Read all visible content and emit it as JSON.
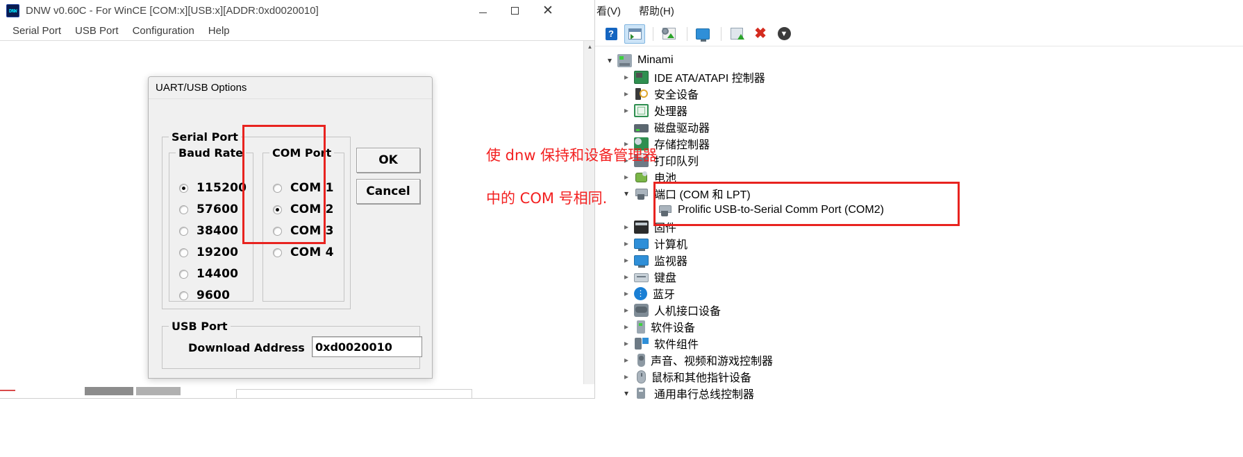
{
  "dnw": {
    "title": "DNW v0.60C - For WinCE   [COM:x][USB:x][ADDR:0xd0020010]",
    "app_icon": "DNW",
    "window_controls": {
      "minimize": "minimize-icon",
      "maximize": "maximize-icon",
      "close": "close-icon"
    },
    "menu": [
      "Serial Port",
      "USB Port",
      "Configuration",
      "Help"
    ]
  },
  "uart_dialog": {
    "title": "UART/USB Options",
    "serial_group": "Serial Port",
    "baud_group": "Baud Rate",
    "com_group": "COM Port",
    "usb_group": "USB Port",
    "baud_rates": [
      {
        "label": "115200",
        "checked": true
      },
      {
        "label": "57600",
        "checked": false
      },
      {
        "label": "38400",
        "checked": false
      },
      {
        "label": "19200",
        "checked": false
      },
      {
        "label": "14400",
        "checked": false
      },
      {
        "label": "9600",
        "checked": false
      }
    ],
    "com_ports": [
      {
        "label": "COM 1",
        "checked": false
      },
      {
        "label": "COM 2",
        "checked": true
      },
      {
        "label": "COM 3",
        "checked": false
      },
      {
        "label": "COM 4",
        "checked": false
      }
    ],
    "download_address_label": "Download Address",
    "download_address_value": "0xd0020010",
    "ok_label": "OK",
    "cancel_label": "Cancel",
    "highlight_color": "#e8231f"
  },
  "annotation": {
    "line1": "使 dnw 保持和设备管理器",
    "line2": "中的 COM 号相同.",
    "color": "#f32020"
  },
  "device_manager": {
    "menu": [
      "看(V)",
      "帮助(H)"
    ],
    "toolbar": [
      {
        "name": "help-icon"
      },
      {
        "name": "properties-icon",
        "selected": true
      },
      {
        "name": "scan-hardware-changes-icon"
      },
      {
        "name": "monitor-icon"
      },
      {
        "name": "update-driver-icon"
      },
      {
        "name": "disable-device-icon"
      },
      {
        "name": "install-device-icon"
      }
    ],
    "tree": [
      {
        "label": "Minami",
        "indent": 0,
        "chevron": "open",
        "icon": "computer-icon"
      },
      {
        "label": "IDE ATA/ATAPI 控制器",
        "indent": 1,
        "chevron": "closed",
        "icon": "ide-controller-icon"
      },
      {
        "label": "安全设备",
        "indent": 1,
        "chevron": "closed",
        "icon": "security-device-icon"
      },
      {
        "label": "处理器",
        "indent": 1,
        "chevron": "closed",
        "icon": "processor-icon"
      },
      {
        "label": "磁盘驱动器",
        "indent": 1,
        "chevron": "none",
        "icon": "disk-drive-icon"
      },
      {
        "label": "存储控制器",
        "indent": 1,
        "chevron": "closed",
        "icon": "storage-controller-icon"
      },
      {
        "label": "打印队列",
        "indent": 1,
        "chevron": "closed",
        "icon": "print-queue-icon"
      },
      {
        "label": "电池",
        "indent": 1,
        "chevron": "closed",
        "icon": "battery-icon"
      },
      {
        "label": "端口 (COM 和 LPT)",
        "indent": 1,
        "chevron": "open",
        "icon": "port-icon"
      },
      {
        "label": "Prolific USB-to-Serial Comm Port (COM2)",
        "indent": 2,
        "chevron": "none",
        "icon": "serial-port-icon"
      },
      {
        "label": "固件",
        "indent": 1,
        "chevron": "closed",
        "icon": "firmware-icon"
      },
      {
        "label": "计算机",
        "indent": 1,
        "chevron": "closed",
        "icon": "computer-node-icon"
      },
      {
        "label": "监视器",
        "indent": 1,
        "chevron": "closed",
        "icon": "monitor-node-icon"
      },
      {
        "label": "键盘",
        "indent": 1,
        "chevron": "closed",
        "icon": "keyboard-icon"
      },
      {
        "label": "蓝牙",
        "indent": 1,
        "chevron": "closed",
        "icon": "bluetooth-icon"
      },
      {
        "label": "人机接口设备",
        "indent": 1,
        "chevron": "closed",
        "icon": "hid-icon"
      },
      {
        "label": "软件设备",
        "indent": 1,
        "chevron": "closed",
        "icon": "software-device-icon"
      },
      {
        "label": "软件组件",
        "indent": 1,
        "chevron": "closed",
        "icon": "software-component-icon"
      },
      {
        "label": "声音、视频和游戏控制器",
        "indent": 1,
        "chevron": "closed",
        "icon": "sound-video-icon"
      },
      {
        "label": "鼠标和其他指针设备",
        "indent": 1,
        "chevron": "closed",
        "icon": "mouse-icon"
      },
      {
        "label": "通用串行总线控制器",
        "indent": 1,
        "chevron": "open",
        "icon": "usb-controller-icon"
      }
    ],
    "highlight_color": "#e8231f"
  }
}
